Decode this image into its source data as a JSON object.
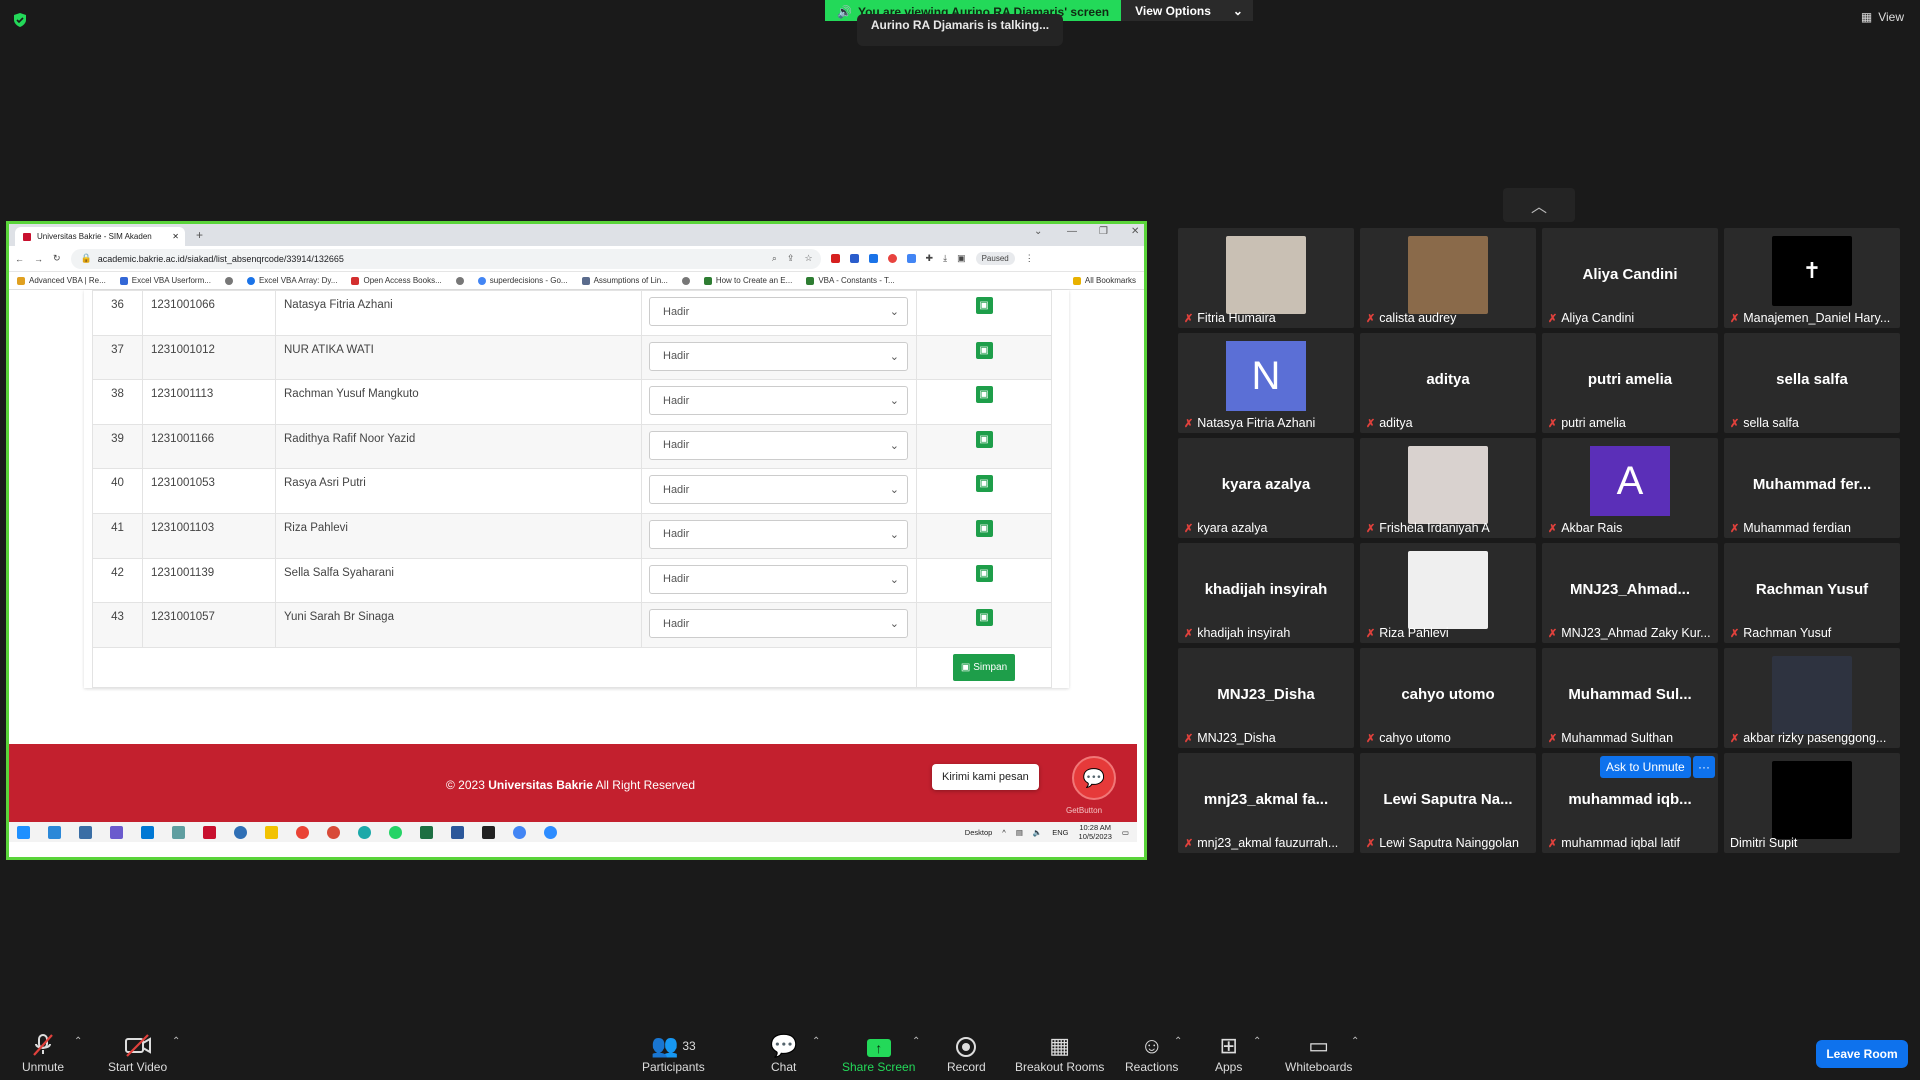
{
  "zoom": {
    "viewing_banner": "You are viewing Aurino RA Djamaris' screen",
    "view_options": "View Options",
    "talking": "Aurino RA Djamaris is talking...",
    "view_button": "View"
  },
  "browser": {
    "tab_title": "Universitas Bakrie - SIM Akaden",
    "url": "academic.bakrie.ac.id/siakad/list_absenqrcode/33914/132665",
    "paused": "Paused",
    "bookmarks": [
      "Advanced VBA | Re...",
      "Excel VBA Userform...",
      "Excel VBA Array: Dy...",
      "Open Access Books...",
      "superdecisions - Go...",
      "Assumptions of Lin...",
      "How to Create an E...",
      "VBA - Constants - T..."
    ],
    "all_bookmarks": "All Bookmarks"
  },
  "attendance": {
    "rows": [
      {
        "no": "36",
        "nim": "1231001066",
        "name": "Natasya Fitria Azhani",
        "status": "Hadir"
      },
      {
        "no": "37",
        "nim": "1231001012",
        "name": "NUR ATIKA WATI",
        "status": "Hadir"
      },
      {
        "no": "38",
        "nim": "1231001113",
        "name": "Rachman Yusuf Mangkuto",
        "status": "Hadir"
      },
      {
        "no": "39",
        "nim": "1231001166",
        "name": "Radithya Rafif Noor Yazid",
        "status": "Hadir"
      },
      {
        "no": "40",
        "nim": "1231001053",
        "name": "Rasya Asri Putri",
        "status": "Hadir"
      },
      {
        "no": "41",
        "nim": "1231001103",
        "name": "Riza Pahlevi",
        "status": "Hadir"
      },
      {
        "no": "42",
        "nim": "1231001139",
        "name": "Sella Salfa Syaharani",
        "status": "Hadir"
      },
      {
        "no": "43",
        "nim": "1231001057",
        "name": "Yuni Sarah Br Sinaga",
        "status": "Hadir"
      }
    ],
    "simpan": "Simpan"
  },
  "footer": {
    "copyright_prefix": "© 2023",
    "org": "Universitas Bakrie",
    "copyright_suffix": "All Right Reserved",
    "chat_prompt": "Kirimi kami pesan",
    "getbutton": "GetButton"
  },
  "taskbar": {
    "desktop": "Desktop",
    "lang": "ENG",
    "time": "10:28 AM",
    "date": "10/5/2023"
  },
  "participants": [
    {
      "label": "Fitria Humaira",
      "display": "",
      "kind": "photo",
      "color": "#c9c0b4"
    },
    {
      "label": "calista audrey",
      "display": "",
      "kind": "photo",
      "color": "#8a6a4a"
    },
    {
      "label": "Aliya Candini",
      "display": "Aliya Candini",
      "kind": "name"
    },
    {
      "label": "Manajemen_Daniel Hary...",
      "display": "",
      "kind": "cross"
    },
    {
      "label": "Natasya Fitria Azhani",
      "display": "N",
      "kind": "letter",
      "color": "#5b6fd6"
    },
    {
      "label": "aditya",
      "display": "aditya",
      "kind": "name"
    },
    {
      "label": "putri amelia",
      "display": "putri amelia",
      "kind": "name"
    },
    {
      "label": "sella salfa",
      "display": "sella salfa",
      "kind": "name"
    },
    {
      "label": "kyara azalya",
      "display": "kyara azalya",
      "kind": "name"
    },
    {
      "label": "Frishela Irdaniyah A",
      "display": "",
      "kind": "photo",
      "color": "#d9d2cf"
    },
    {
      "label": "Akbar Rais",
      "display": "A",
      "kind": "letter",
      "color": "#5b2fb8"
    },
    {
      "label": "Muhammad ferdian",
      "display": "Muhammad  fer...",
      "kind": "name"
    },
    {
      "label": "khadijah insyirah",
      "display": "khadijah insyirah",
      "kind": "name"
    },
    {
      "label": "Riza Pahlevi",
      "display": "",
      "kind": "photo",
      "color": "#efefef"
    },
    {
      "label": "MNJ23_Ahmad Zaky Kur...",
      "display": "MNJ23_Ahmad...",
      "kind": "name"
    },
    {
      "label": "Rachman Yusuf",
      "display": "Rachman Yusuf",
      "kind": "name"
    },
    {
      "label": "MNJ23_Disha",
      "display": "MNJ23_Disha",
      "kind": "name"
    },
    {
      "label": "cahyo utomo",
      "display": "cahyo utomo",
      "kind": "name"
    },
    {
      "label": "Muhammad Sulthan",
      "display": "Muhammad  Sul...",
      "kind": "name"
    },
    {
      "label": "akbar rizky pasenggong...",
      "display": "",
      "kind": "photo",
      "color": "#2e3340"
    },
    {
      "label": "mnj23_akmal fauzurrah...",
      "display": "mnj23_akmal  fa...",
      "kind": "name"
    },
    {
      "label": "Lewi Saputra Nainggolan",
      "display": "Lewi  Saputra  Na...",
      "kind": "name"
    },
    {
      "label": "muhammad iqbal latif",
      "display": "muhammad  iqb...",
      "kind": "name"
    },
    {
      "label": "Dimitri Supit",
      "display": "",
      "kind": "black",
      "nomic": true
    }
  ],
  "ask_to_unmute": "Ask to Unmute",
  "more_dots": "···",
  "toolbar": {
    "unmute": "Unmute",
    "start_video": "Start Video",
    "participants": "Participants",
    "participants_count": "33",
    "chat": "Chat",
    "share_screen": "Share Screen",
    "record": "Record",
    "breakout_rooms": "Breakout Rooms",
    "reactions": "Reactions",
    "apps": "Apps",
    "whiteboards": "Whiteboards",
    "leave_room": "Leave Room"
  },
  "colors": {
    "share_border": "#5ad43a",
    "banner_green": "#23d959",
    "footer_red": "#c3202e",
    "zoom_blue": "#0e72ed",
    "save_green": "#1e9e4a"
  }
}
